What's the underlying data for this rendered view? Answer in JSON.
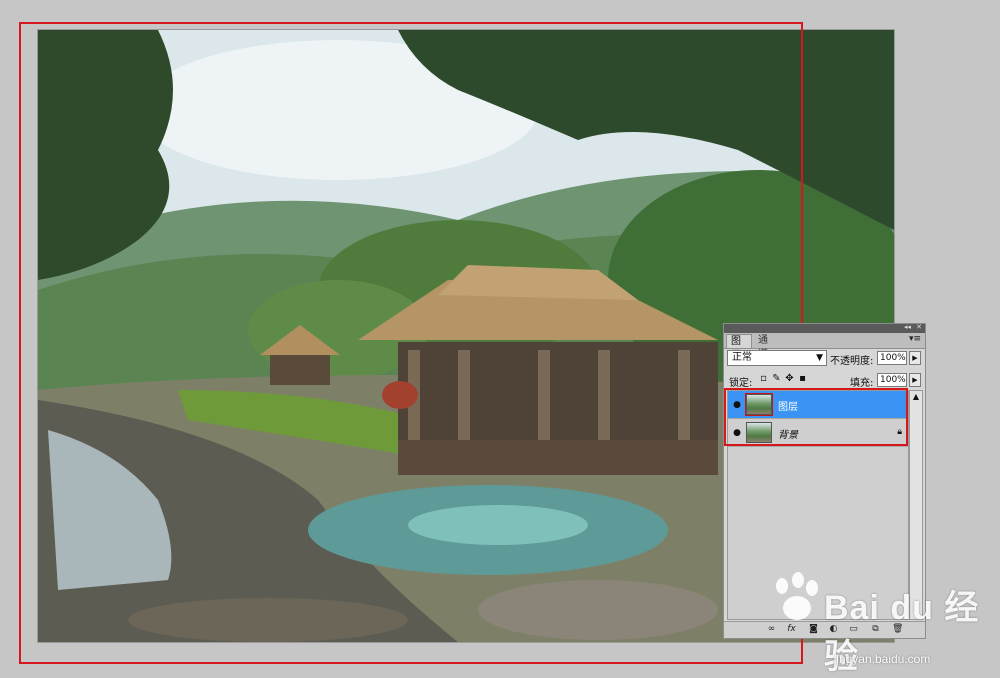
{
  "layers_panel": {
    "tabs": [
      {
        "label": "图层"
      },
      {
        "label": "通道"
      }
    ],
    "blend_mode": "正常",
    "opacity_label": "不透明度:",
    "opacity_value": "100%",
    "lock_label": "锁定:",
    "fill_label": "填充:",
    "fill_value": "100%",
    "layers": [
      {
        "name": "图层",
        "selected": true,
        "visible": true
      },
      {
        "name": "背景",
        "selected": false,
        "visible": true,
        "locked": true
      }
    ],
    "bottom_icons": [
      "link-icon",
      "fx-icon",
      "mask-icon",
      "adjustment-icon",
      "folder-icon",
      "new-layer-icon",
      "trash-icon"
    ]
  },
  "watermark": {
    "brand": "Bai du 经验",
    "url": "jingyan.baidu.com"
  },
  "annotation_color": "#d4181c",
  "selection_color": "#3b93f3"
}
